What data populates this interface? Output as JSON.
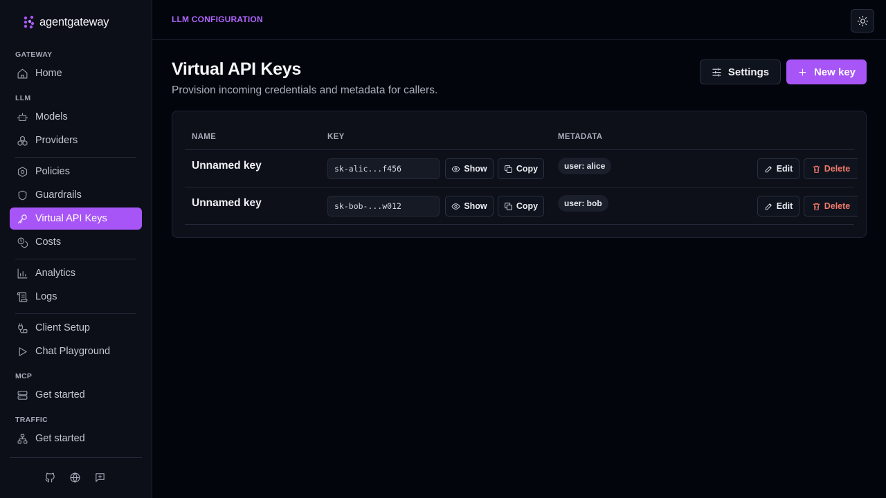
{
  "brand": {
    "name": "agentgateway"
  },
  "colors": {
    "accent": "#a855f7",
    "background": "#03050c",
    "danger": "#f07a6a"
  },
  "sidebar": {
    "sections": [
      {
        "label": "GATEWAY",
        "items": [
          {
            "label": "Home",
            "icon": "home-icon"
          }
        ]
      },
      {
        "label": "LLM",
        "items": [
          {
            "label": "Models",
            "icon": "robot-icon"
          },
          {
            "label": "Providers",
            "icon": "cubes-icon"
          },
          {
            "label": "Policies",
            "icon": "hexagon-icon"
          },
          {
            "label": "Guardrails",
            "icon": "shield-icon"
          },
          {
            "label": "Virtual API Keys",
            "icon": "key-icon",
            "active": true
          },
          {
            "label": "Costs",
            "icon": "coins-icon"
          },
          {
            "label": "Analytics",
            "icon": "bar-chart-icon"
          },
          {
            "label": "Logs",
            "icon": "scroll-icon"
          },
          {
            "label": "Client Setup",
            "icon": "plug-icon"
          },
          {
            "label": "Chat Playground",
            "icon": "play-icon"
          }
        ]
      },
      {
        "label": "MCP",
        "items": [
          {
            "label": "Get started",
            "icon": "server-icon"
          }
        ]
      },
      {
        "label": "TRAFFIC",
        "items": [
          {
            "label": "Get started",
            "icon": "network-icon"
          }
        ]
      }
    ],
    "footer_icons": [
      "github-icon",
      "globe-icon",
      "feedback-icon"
    ]
  },
  "topbar": {
    "breadcrumb": "LLM CONFIGURATION",
    "theme_icon": "sun-icon"
  },
  "header": {
    "title": "Virtual API Keys",
    "subtitle": "Provision incoming credentials and metadata for callers.",
    "settings_label": "Settings",
    "new_key_label": "New key"
  },
  "table": {
    "columns": [
      "NAME",
      "KEY",
      "METADATA"
    ],
    "show_label": "Show",
    "copy_label": "Copy",
    "edit_label": "Edit",
    "delete_label": "Delete",
    "rows": [
      {
        "name": "Unnamed key",
        "key": "sk-alic...f456",
        "metadata": "user: alice"
      },
      {
        "name": "Unnamed key",
        "key": "sk-bob-...w012",
        "metadata": "user: bob"
      }
    ]
  }
}
